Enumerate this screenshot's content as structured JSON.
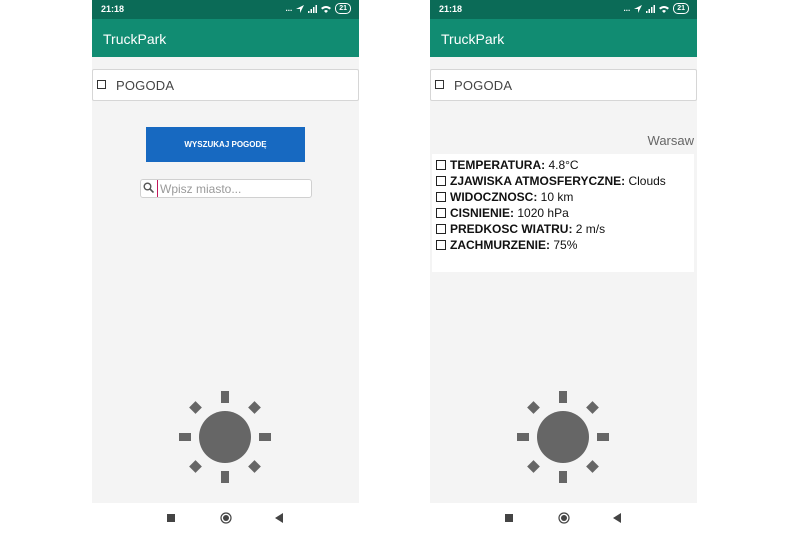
{
  "status_bar": {
    "time": "21:18",
    "indicators": "...",
    "battery": "21"
  },
  "app": {
    "title": "TruckPark"
  },
  "weather_card": {
    "label": "POGODA"
  },
  "left_screen": {
    "search_button_label": "WYSZUKAJ POGODĘ",
    "search_placeholder": "Wpisz miasto...",
    "search_value": ""
  },
  "right_screen": {
    "city": "Warsaw",
    "weather_info": [
      {
        "key": "TEMPERATURA:",
        "value": "4.8°C"
      },
      {
        "key": "ZJAWISKA ATMOSFERYCZNE:",
        "value": "Clouds"
      },
      {
        "key": "WIDOCZNOSC:",
        "value": "10 km"
      },
      {
        "key": "CISNIENIE:",
        "value": "1020 hPa"
      },
      {
        "key": "PREDKOSC WIATRU:",
        "value": "2 m/s"
      },
      {
        "key": "ZACHMURZENIE:",
        "value": "75%"
      }
    ]
  },
  "icons": {
    "sun": "sun-icon",
    "search": "search-icon",
    "nav": [
      "recents-square-icon",
      "home-circle-icon",
      "back-triangle-icon"
    ]
  },
  "colors": {
    "status_bar": "#0b6b57",
    "app_bar": "#118c72",
    "button": "#1769c1",
    "background": "#f4f4f4",
    "sun": "#666666"
  }
}
